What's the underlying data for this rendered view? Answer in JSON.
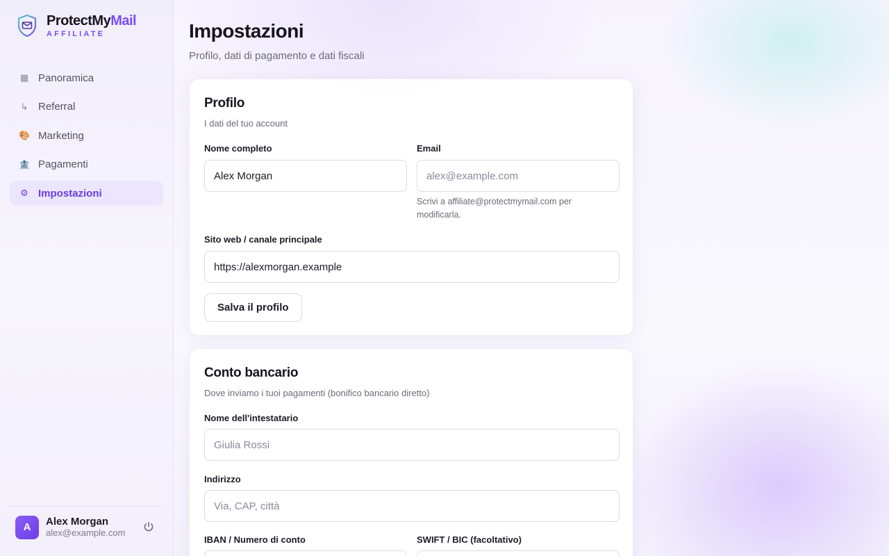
{
  "brand": {
    "name_part1": "ProtectMy",
    "name_part2": "Mail",
    "subtitle": "AFFILIATE"
  },
  "nav": [
    {
      "label": "Panoramica",
      "icon": "grid-icon",
      "glyph": "▦"
    },
    {
      "label": "Referral",
      "icon": "arrow-return-icon",
      "glyph": "↳"
    },
    {
      "label": "Marketing",
      "icon": "palette-icon",
      "glyph": "🎨"
    },
    {
      "label": "Pagamenti",
      "icon": "bank-icon",
      "glyph": "🏦"
    },
    {
      "label": "Impostazioni",
      "icon": "gear-icon",
      "glyph": "⚙",
      "active": true
    }
  ],
  "user": {
    "initial": "A",
    "name": "Alex Morgan",
    "email": "alex@example.com"
  },
  "page": {
    "title": "Impostazioni",
    "subtitle": "Profilo, dati di pagamento e dati fiscali"
  },
  "profile": {
    "title": "Profilo",
    "subtitle": "I dati del tuo account",
    "fullname_label": "Nome completo",
    "fullname_value": "Alex Morgan",
    "email_label": "Email",
    "email_placeholder": "alex@example.com",
    "email_hint": "Scrivi a affiliate@protectmymail.com per modificarla.",
    "website_label": "Sito web / canale principale",
    "website_value": "https://alexmorgan.example",
    "save_label": "Salva il profilo"
  },
  "bank": {
    "title": "Conto bancario",
    "subtitle": "Dove inviamo i tuoi pagamenti (bonifico bancario diretto)",
    "holder_label": "Nome dell'intestatario",
    "holder_placeholder": "Giulia Rossi",
    "address_label": "Indirizzo",
    "address_placeholder": "Via, CAP, città",
    "iban_label": "IBAN / Numero di conto",
    "swift_label": "SWIFT / BIC (facoltativo)"
  },
  "colors": {
    "accent": "#7a4df0",
    "active_bg": "#ece5fe",
    "text": "#1c1a26"
  }
}
